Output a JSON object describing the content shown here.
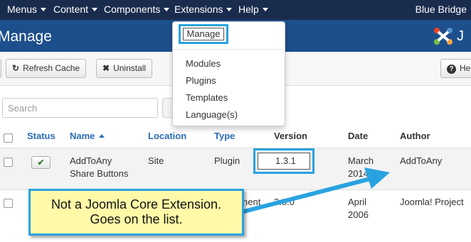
{
  "navbar": {
    "menus": [
      "Menus",
      "Content",
      "Components",
      "Extensions",
      "Help"
    ],
    "site_name": "Blue Bridge"
  },
  "subheader": {
    "title": "Manage",
    "logo_text": "J"
  },
  "toolbar": {
    "refresh_label": "Refresh Cache",
    "uninstall_label": "Uninstall",
    "help_label": "He"
  },
  "search": {
    "placeholder": "Search"
  },
  "dropdown": {
    "items": [
      "Manage",
      "Modules",
      "Plugins",
      "Templates",
      "Language(s)"
    ]
  },
  "table": {
    "headers": [
      "Status",
      "Name",
      "Location",
      "Type",
      "Version",
      "Date",
      "Author"
    ],
    "rows": [
      {
        "name_line1": "AddToAny",
        "name_line2": "Share Buttons",
        "location": "Site",
        "type": "Plugin",
        "version": "1.3.1",
        "date_line1": "March",
        "date_line2": "2014",
        "author": "AddToAny"
      },
      {
        "type_fragment": "nent",
        "version": "3.0.0",
        "date_line1": "April",
        "date_line2": "2006",
        "author": "Joomla! Project"
      }
    ]
  },
  "callout": {
    "line1": "Not a Joomla Core Extension.",
    "line2": "Goes on the list."
  },
  "colors": {
    "navbar": "#1a2c4e",
    "subheader": "#1d4f8c",
    "highlight": "#29a3e0",
    "callout_bg": "#fff9a8"
  }
}
